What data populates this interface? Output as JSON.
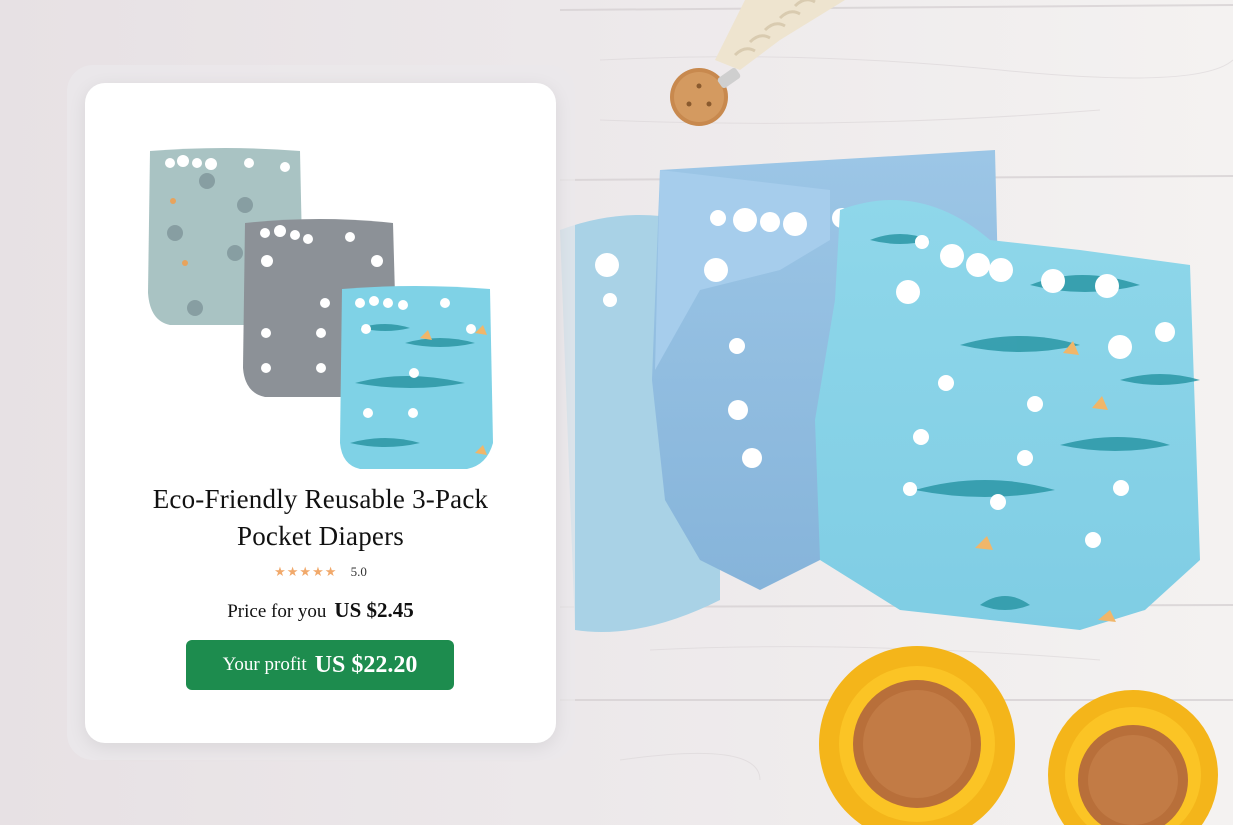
{
  "product": {
    "title_line1": "Eco-Friendly Reusable 3-Pack",
    "title_line2": "Pocket Diapers",
    "stars": "★★★★★",
    "rating": "5.0",
    "price_label": "Price for you",
    "price_value": "US $2.45",
    "profit_label": "Your profit",
    "profit_value": "US $22.20"
  },
  "colors": {
    "profit_button": "#1d8c4e",
    "stars": "#f1a96b"
  }
}
